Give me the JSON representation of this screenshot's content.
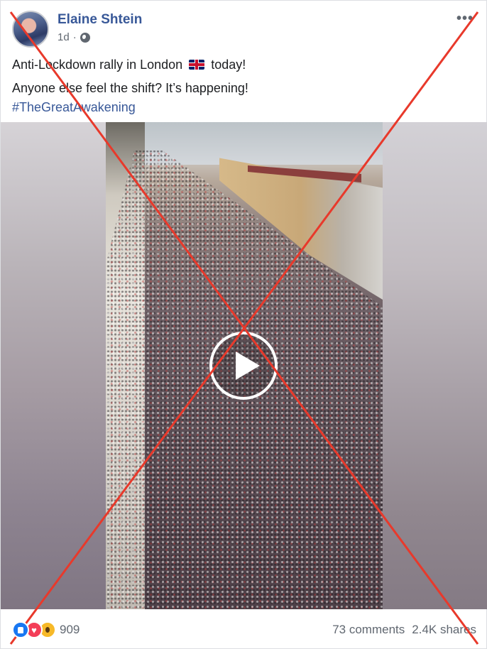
{
  "post": {
    "author": "Elaine Shtein",
    "time": "1d",
    "separator": "·",
    "privacy_icon": "globe-icon",
    "more_icon": "more-options-icon",
    "line1_before_flag": "Anti-Lockdown rally in London",
    "flag_icon": "uk-flag-icon",
    "line1_after_flag": "today!",
    "line2": "Anyone else feel the shift? It’s happening!",
    "hashtag": "#TheGreatAwakening"
  },
  "video": {
    "play_icon": "play-icon"
  },
  "overlay": {
    "cross_color": "#e8392b"
  },
  "footer": {
    "reaction_icons": [
      "like-icon",
      "love-icon",
      "wow-icon"
    ],
    "reaction_count": "909",
    "comments": "73 comments",
    "shares": "2.4K shares"
  },
  "colors": {
    "link": "#385898",
    "secondary_text": "#606770",
    "like": "#1877f2",
    "love": "#f33e58",
    "wow": "#f7b928"
  }
}
